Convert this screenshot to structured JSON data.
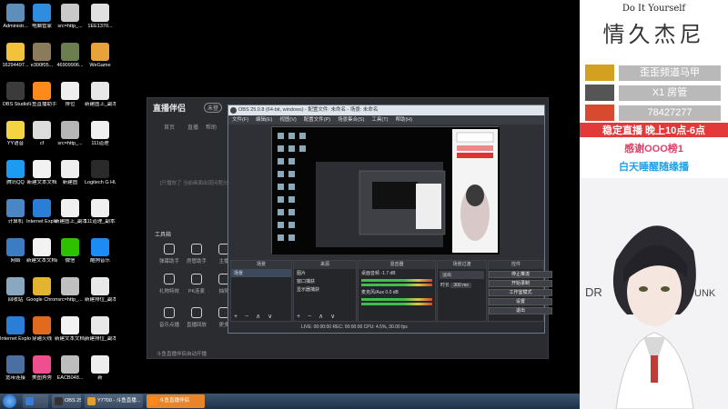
{
  "desktop": {
    "icons": [
      {
        "label": "Administr...",
        "color": "#5d8fb8"
      },
      {
        "label": "电脑管家",
        "color": "#2f8de0"
      },
      {
        "label": "src=http_...",
        "color": "#c9c9c9"
      },
      {
        "label": "1EE1370...",
        "color": "#e0e0e0"
      },
      {
        "label": "16294497...",
        "color": "#f3c23b"
      },
      {
        "label": "e300f05...",
        "color": "#8a7b5a"
      },
      {
        "label": "46909906...",
        "color": "#6c7d4f"
      },
      {
        "label": "WeGame",
        "color": "#e7a33a"
      },
      {
        "label": "OBS Studio",
        "color": "#3b3b3b"
      },
      {
        "label": "斗鱼直播助手",
        "color": "#ff8a1c"
      },
      {
        "label": "排位",
        "color": "#eeeeee"
      },
      {
        "label": "新建图上_副本3333_副本",
        "color": "#e8e8e8"
      },
      {
        "label": "YY语音",
        "color": "#f5d443"
      },
      {
        "label": "cf",
        "color": "#dcdcdc"
      },
      {
        "label": "src=http_...",
        "color": "#b5b5b5"
      },
      {
        "label": "111道理",
        "color": "#f0f0f0"
      },
      {
        "label": "腾讯QQ",
        "color": "#1d9bf0"
      },
      {
        "label": "新建文本文档",
        "color": "#f2f2f2"
      },
      {
        "label": "新建图",
        "color": "#efefef"
      },
      {
        "label": "Logitech G HUB",
        "color": "#2a2a2a"
      },
      {
        "label": "计算机",
        "color": "#4b86c4"
      },
      {
        "label": "Internet Explorer",
        "color": "#2a7ed6"
      },
      {
        "label": "新建图上_副本",
        "color": "#f0f0f0"
      },
      {
        "label": "111道理_副本22222_...",
        "color": "#f0f0f0"
      },
      {
        "label": "网络",
        "color": "#3d7cc0"
      },
      {
        "label": "新建文本文档(2)",
        "color": "#f2f2f2"
      },
      {
        "label": "微信",
        "color": "#2dc100"
      },
      {
        "label": "酷狗音乐",
        "color": "#1c8bf3"
      },
      {
        "label": "回收站",
        "color": "#8aa7c0"
      },
      {
        "label": "Google Chrome",
        "color": "#e3b52f"
      },
      {
        "label": "src=http_...",
        "color": "#c0c0c0"
      },
      {
        "label": "新建排位_副本_副本",
        "color": "#e8e8e8"
      },
      {
        "label": "Internet Explorer",
        "color": "#2a7ed6"
      },
      {
        "label": "穿越火线",
        "color": "#e06a1e"
      },
      {
        "label": "新建文本文档_副本",
        "color": "#f2f2f2"
      },
      {
        "label": "新建排位_副本_副本_副本",
        "color": "#e8e8e8"
      },
      {
        "label": "宽带连接",
        "color": "#4a6fa0"
      },
      {
        "label": "美图秀秀",
        "color": "#ef4f8f"
      },
      {
        "label": "EACB048...",
        "color": "#bdbdbd"
      },
      {
        "label": "新",
        "color": "#eeeeee"
      }
    ]
  },
  "assistant": {
    "brand": "直播伴侣",
    "badge": "未登",
    "menu": [
      "首页",
      "直播",
      "帮助"
    ],
    "hint": "[只播放了   当前画面出现问题分享了]",
    "tools_title": "工具箱",
    "tools": [
      {
        "label": "弹幕助手"
      },
      {
        "label": "房管助手"
      },
      {
        "label": "主播"
      },
      {
        "label": "礼物特效"
      },
      {
        "label": "PK连麦"
      },
      {
        "label": "抽奖"
      },
      {
        "label": "音乐点播"
      },
      {
        "label": "直播回放"
      },
      {
        "label": "更多"
      }
    ],
    "checkbox": "斗鱼直播伴侣自动开播"
  },
  "obs": {
    "title": "OBS 25.0.8 (64-bit, windows) - 配置文件: 未命名 - 场景: 未命名",
    "menu": [
      "文件(F)",
      "编辑(E)",
      "视图(V)",
      "配置文件(P)",
      "场景集合(S)",
      "工具(T)",
      "帮助(H)"
    ],
    "panels": {
      "scenes": {
        "title": "场景",
        "items": [
          "场景"
        ]
      },
      "sources": {
        "title": "来源",
        "items": [
          "图片",
          "窗口捕获",
          "显示器捕获"
        ]
      },
      "mixer": {
        "title": "混音器",
        "items": [
          {
            "name": "桌面音频",
            "db": "-1.7 dB"
          },
          {
            "name": "麦克风/Aux",
            "db": "0.0 dB"
          }
        ]
      },
      "transitions": {
        "title": "场景过渡",
        "mode": "淡出",
        "duration_label": "时长",
        "duration": "300 ms"
      },
      "controls": {
        "title": "控件",
        "buttons": [
          "停止推流",
          "开始录制",
          "工作室模式",
          "设置",
          "退出"
        ]
      }
    },
    "status": "LIVE: 00:00:00    REC: 00:00:00    CPU: 4.5%, 30.00 fps",
    "footer_symbols": "+ − ∧ ∨"
  },
  "overlay": {
    "subtitle": "Do It Yourself",
    "streamer": "情久杰尼",
    "ranks": [
      {
        "label": "歪歪频道马甲",
        "color": "#d4a020"
      },
      {
        "label": "X1 房管",
        "color": "#555555"
      },
      {
        "label": "78427277",
        "color": "#d84a30"
      }
    ],
    "notices": [
      {
        "text": "稳定直播  晚上10点-6点",
        "color": "#ffffff",
        "bg": "#e23a3a"
      },
      {
        "text": "感谢OOO榜1",
        "color": "#e0406a",
        "bg": "#ffffff"
      },
      {
        "text": "白天睡醒随缘播",
        "color": "#1ea0e8",
        "bg": "#ffffff"
      }
    ],
    "portrait_text_left": "DR",
    "portrait_text_right": "UNK"
  },
  "taskbar": {
    "items": [
      {
        "label": "",
        "color": "#3a7bd5"
      },
      {
        "label": "OBS 25.0.8 (64...",
        "color": "#333333"
      },
      {
        "label": "Y7?00 - 斗鱼直播...",
        "color": "#e0a030"
      },
      {
        "label": "斗鱼直播伴侣",
        "color": "#ff8a1c"
      }
    ]
  }
}
